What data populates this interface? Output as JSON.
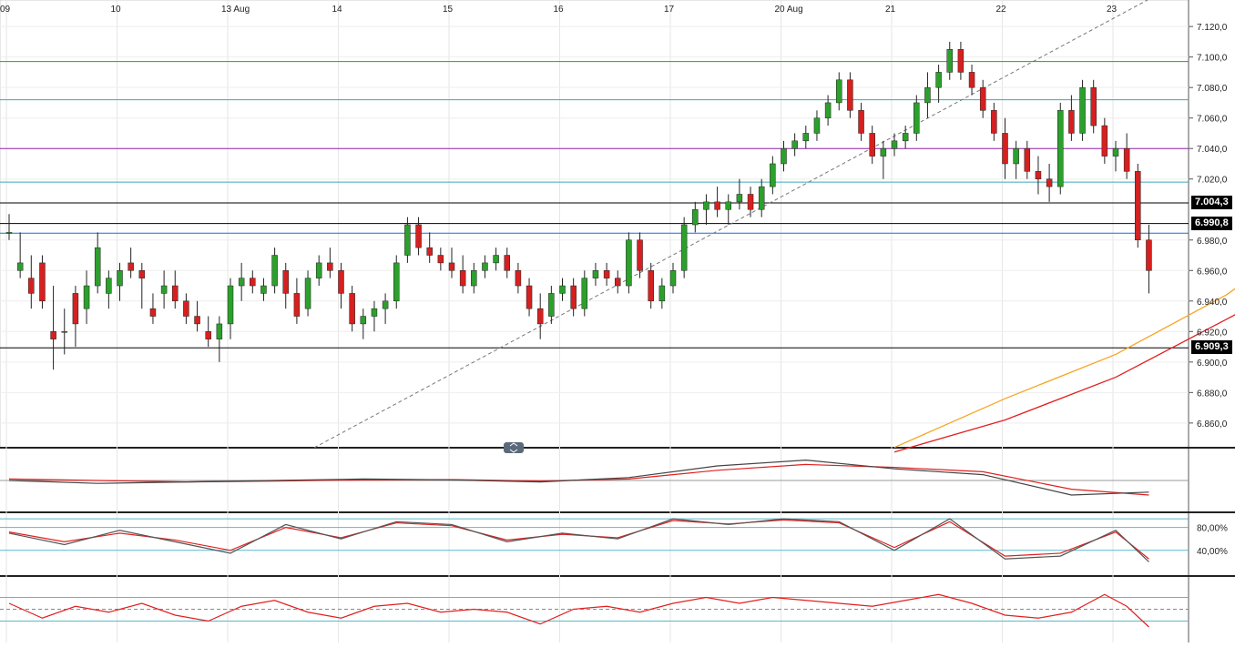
{
  "chart_data": [
    {
      "type": "line",
      "series_kind": "candlestick",
      "title": "",
      "xlabel": "",
      "ylabel": "",
      "x_ticks": [
        "09",
        "10",
        "13 Aug",
        "14",
        "15",
        "16",
        "17",
        "20 Aug",
        "21",
        "22",
        "23"
      ],
      "y_ticks": [
        "7.120,0",
        "7.100,0",
        "7.080,0",
        "7.060,0",
        "7.040,0",
        "7.020,0",
        "6.980,0",
        "6.960,0",
        "6.940,0",
        "6.920,0",
        "6.900,0",
        "6.880,0",
        "6.860,0"
      ],
      "ylim": [
        6.845,
        7.135
      ],
      "price_labels": [
        "7.004,3",
        "6.990,8",
        "6.909,3"
      ],
      "horizontal_levels": [
        {
          "value": 7.097,
          "color": "#2ca02c"
        },
        {
          "value": 7.072,
          "color": "#3fa7b8"
        },
        {
          "value": 7.04,
          "color": "#8e24aa"
        },
        {
          "value": 7.018,
          "color": "#3fa7b8"
        },
        {
          "value": 7.0043,
          "color": "#000000"
        },
        {
          "value": 6.9908,
          "color": "#000000"
        },
        {
          "value": 6.9845,
          "color": "#1f6fd6"
        },
        {
          "value": 6.9093,
          "color": "#000000"
        }
      ],
      "ma_long_orange": [
        [
          8.0,
          6.844
        ],
        [
          9.0,
          6.876
        ],
        [
          10.0,
          6.905
        ],
        [
          11.0,
          6.944
        ],
        [
          11.6,
          6.975
        ],
        [
          11.9,
          6.98
        ]
      ],
      "ma_long_red": [
        [
          8.0,
          6.841
        ],
        [
          9.0,
          6.862
        ],
        [
          10.0,
          6.89
        ],
        [
          11.0,
          6.928
        ],
        [
          11.6,
          6.951
        ],
        [
          11.9,
          6.955
        ]
      ],
      "candles": [
        [
          0.0,
          6.985,
          6.997,
          6.98,
          6.985
        ],
        [
          0.1,
          6.96,
          6.985,
          6.955,
          6.965
        ],
        [
          0.2,
          6.955,
          6.97,
          6.935,
          6.945
        ],
        [
          0.3,
          6.965,
          6.97,
          6.935,
          6.94
        ],
        [
          0.4,
          6.92,
          6.95,
          6.895,
          6.915
        ],
        [
          0.5,
          6.92,
          6.935,
          6.905,
          6.92
        ],
        [
          0.6,
          6.945,
          6.95,
          6.91,
          6.925
        ],
        [
          0.7,
          6.935,
          6.96,
          6.925,
          6.95
        ],
        [
          0.8,
          6.95,
          6.985,
          6.945,
          6.975
        ],
        [
          0.9,
          6.945,
          6.96,
          6.935,
          6.955
        ],
        [
          1.0,
          6.95,
          6.965,
          6.94,
          6.96
        ],
        [
          1.1,
          6.965,
          6.975,
          6.955,
          6.96
        ],
        [
          1.2,
          6.96,
          6.965,
          6.935,
          6.955
        ],
        [
          1.3,
          6.935,
          6.945,
          6.925,
          6.93
        ],
        [
          1.4,
          6.945,
          6.96,
          6.935,
          6.95
        ],
        [
          1.5,
          6.95,
          6.96,
          6.935,
          6.94
        ],
        [
          1.6,
          6.94,
          6.945,
          6.925,
          6.93
        ],
        [
          1.7,
          6.93,
          6.94,
          6.92,
          6.925
        ],
        [
          1.8,
          6.92,
          6.93,
          6.91,
          6.915
        ],
        [
          1.9,
          6.915,
          6.93,
          6.9,
          6.925
        ],
        [
          2.0,
          6.925,
          6.955,
          6.915,
          6.95
        ],
        [
          2.1,
          6.95,
          6.965,
          6.94,
          6.955
        ],
        [
          2.2,
          6.955,
          6.96,
          6.945,
          6.95
        ],
        [
          2.3,
          6.945,
          6.955,
          6.94,
          6.95
        ],
        [
          2.4,
          6.95,
          6.975,
          6.945,
          6.97
        ],
        [
          2.5,
          6.96,
          6.965,
          6.935,
          6.945
        ],
        [
          2.6,
          6.945,
          6.955,
          6.925,
          6.93
        ],
        [
          2.7,
          6.935,
          6.96,
          6.93,
          6.955
        ],
        [
          2.8,
          6.955,
          6.97,
          6.95,
          6.965
        ],
        [
          2.9,
          6.965,
          6.975,
          6.955,
          6.96
        ],
        [
          3.0,
          6.96,
          6.965,
          6.935,
          6.945
        ],
        [
          3.1,
          6.945,
          6.95,
          6.92,
          6.925
        ],
        [
          3.2,
          6.925,
          6.935,
          6.915,
          6.93
        ],
        [
          3.3,
          6.93,
          6.94,
          6.92,
          6.935
        ],
        [
          3.4,
          6.935,
          6.945,
          6.925,
          6.94
        ],
        [
          3.5,
          6.94,
          6.97,
          6.935,
          6.965
        ],
        [
          3.6,
          6.97,
          6.995,
          6.965,
          6.99
        ],
        [
          3.7,
          6.99,
          6.995,
          6.97,
          6.975
        ],
        [
          3.8,
          6.975,
          6.985,
          6.965,
          6.97
        ],
        [
          3.9,
          6.97,
          6.975,
          6.96,
          6.965
        ],
        [
          4.0,
          6.965,
          6.975,
          6.955,
          6.96
        ],
        [
          4.1,
          6.96,
          6.97,
          6.945,
          6.95
        ],
        [
          4.2,
          6.95,
          6.965,
          6.945,
          6.96
        ],
        [
          4.3,
          6.96,
          6.97,
          6.955,
          6.965
        ],
        [
          4.4,
          6.965,
          6.975,
          6.96,
          6.97
        ],
        [
          4.5,
          6.97,
          6.975,
          6.955,
          6.96
        ],
        [
          4.6,
          6.96,
          6.965,
          6.945,
          6.95
        ],
        [
          4.7,
          6.95,
          6.955,
          6.93,
          6.935
        ],
        [
          4.8,
          6.935,
          6.945,
          6.915,
          6.925
        ],
        [
          4.9,
          6.93,
          6.95,
          6.925,
          6.945
        ],
        [
          5.0,
          6.945,
          6.955,
          6.94,
          6.95
        ],
        [
          5.1,
          6.95,
          6.955,
          6.93,
          6.935
        ],
        [
          5.2,
          6.935,
          6.96,
          6.93,
          6.955
        ],
        [
          5.3,
          6.955,
          6.965,
          6.95,
          6.96
        ],
        [
          5.4,
          6.96,
          6.965,
          6.95,
          6.955
        ],
        [
          5.5,
          6.955,
          6.96,
          6.945,
          6.95
        ],
        [
          5.6,
          6.95,
          6.985,
          6.945,
          6.98
        ],
        [
          5.7,
          6.98,
          6.985,
          6.955,
          6.96
        ],
        [
          5.8,
          6.96,
          6.965,
          6.935,
          6.94
        ],
        [
          5.9,
          6.94,
          6.955,
          6.935,
          6.95
        ],
        [
          6.0,
          6.95,
          6.965,
          6.945,
          6.96
        ],
        [
          6.1,
          6.96,
          6.995,
          6.955,
          6.99
        ],
        [
          6.2,
          6.99,
          7.005,
          6.985,
          7.0
        ],
        [
          6.3,
          7.0,
          7.01,
          6.99,
          7.005
        ],
        [
          6.4,
          7.005,
          7.015,
          6.995,
          7.0
        ],
        [
          6.5,
          7.0,
          7.01,
          6.99,
          7.005
        ],
        [
          6.6,
          7.005,
          7.02,
          7.0,
          7.01
        ],
        [
          6.7,
          7.01,
          7.015,
          6.995,
          7.0
        ],
        [
          6.8,
          7.0,
          7.02,
          6.995,
          7.015
        ],
        [
          6.9,
          7.015,
          7.035,
          7.01,
          7.03
        ],
        [
          7.0,
          7.03,
          7.045,
          7.025,
          7.04
        ],
        [
          7.1,
          7.04,
          7.05,
          7.035,
          7.045
        ],
        [
          7.2,
          7.045,
          7.055,
          7.04,
          7.05
        ],
        [
          7.3,
          7.05,
          7.065,
          7.045,
          7.06
        ],
        [
          7.4,
          7.06,
          7.075,
          7.055,
          7.07
        ],
        [
          7.5,
          7.07,
          7.09,
          7.065,
          7.085
        ],
        [
          7.6,
          7.085,
          7.09,
          7.06,
          7.065
        ],
        [
          7.7,
          7.065,
          7.07,
          7.045,
          7.05
        ],
        [
          7.8,
          7.05,
          7.055,
          7.03,
          7.035
        ],
        [
          7.9,
          7.035,
          7.045,
          7.02,
          7.04
        ],
        [
          8.0,
          7.04,
          7.05,
          7.035,
          7.045
        ],
        [
          8.1,
          7.045,
          7.055,
          7.04,
          7.05
        ],
        [
          8.2,
          7.05,
          7.075,
          7.045,
          7.07
        ],
        [
          8.3,
          7.07,
          7.09,
          7.06,
          7.08
        ],
        [
          8.4,
          7.08,
          7.095,
          7.07,
          7.09
        ],
        [
          8.5,
          7.09,
          7.11,
          7.085,
          7.105
        ],
        [
          8.6,
          7.105,
          7.11,
          7.085,
          7.09
        ],
        [
          8.7,
          7.09,
          7.095,
          7.075,
          7.08
        ],
        [
          8.8,
          7.08,
          7.085,
          7.06,
          7.065
        ],
        [
          8.9,
          7.065,
          7.07,
          7.045,
          7.05
        ],
        [
          9.0,
          7.05,
          7.06,
          7.02,
          7.03
        ],
        [
          9.1,
          7.03,
          7.045,
          7.02,
          7.04
        ],
        [
          9.2,
          7.04,
          7.045,
          7.02,
          7.025
        ],
        [
          9.3,
          7.025,
          7.035,
          7.01,
          7.02
        ],
        [
          9.4,
          7.02,
          7.03,
          7.005,
          7.015
        ],
        [
          9.5,
          7.015,
          7.07,
          7.01,
          7.065
        ],
        [
          9.6,
          7.065,
          7.075,
          7.045,
          7.05
        ],
        [
          9.7,
          7.05,
          7.085,
          7.045,
          7.08
        ],
        [
          9.8,
          7.08,
          7.085,
          7.05,
          7.055
        ],
        [
          9.9,
          7.055,
          7.06,
          7.03,
          7.035
        ],
        [
          10.0,
          7.035,
          7.045,
          7.025,
          7.04
        ],
        [
          10.1,
          7.04,
          7.05,
          7.02,
          7.025
        ],
        [
          10.2,
          7.025,
          7.03,
          6.975,
          6.98
        ],
        [
          10.3,
          6.98,
          6.99,
          6.945,
          6.96
        ]
      ]
    },
    {
      "type": "area",
      "series_kind": "macd-histogram",
      "title": "",
      "ylim": [
        -1,
        1
      ],
      "x": [
        0.0,
        0.8,
        1.6,
        2.4,
        3.2,
        4.0,
        4.8,
        5.6,
        6.4,
        7.2,
        8.0,
        8.8,
        9.6,
        10.3
      ],
      "macd": [
        0.0,
        -0.1,
        -0.05,
        0.0,
        0.05,
        0.02,
        -0.05,
        0.1,
        0.5,
        0.7,
        0.4,
        0.2,
        -0.5,
        -0.4
      ],
      "signal": [
        0.05,
        0.0,
        -0.05,
        -0.02,
        0.02,
        0.03,
        -0.02,
        0.05,
        0.35,
        0.55,
        0.45,
        0.3,
        -0.3,
        -0.5
      ]
    },
    {
      "type": "line",
      "series_kind": "stochastic",
      "title": "",
      "y_ticks": [
        "80,00%",
        "40,00%"
      ],
      "ylim": [
        0,
        100
      ],
      "levels": [
        95,
        80,
        40
      ],
      "x": [
        0.0,
        0.5,
        1.0,
        1.5,
        2.0,
        2.5,
        3.0,
        3.5,
        4.0,
        4.5,
        5.0,
        5.5,
        6.0,
        6.5,
        7.0,
        7.5,
        8.0,
        8.5,
        9.0,
        9.5,
        10.0,
        10.3
      ],
      "k": [
        70,
        50,
        75,
        55,
        35,
        85,
        60,
        90,
        85,
        55,
        70,
        60,
        95,
        85,
        95,
        90,
        40,
        95,
        25,
        30,
        75,
        20
      ],
      "d": [
        72,
        55,
        70,
        58,
        40,
        80,
        62,
        88,
        83,
        58,
        68,
        62,
        92,
        86,
        93,
        88,
        45,
        90,
        30,
        35,
        72,
        25
      ]
    },
    {
      "type": "line",
      "series_kind": "rsi",
      "title": "",
      "ylim": [
        0,
        100
      ],
      "levels": [
        70,
        50,
        30
      ],
      "x": [
        0.0,
        0.3,
        0.6,
        0.9,
        1.2,
        1.5,
        1.8,
        2.1,
        2.4,
        2.7,
        3.0,
        3.3,
        3.6,
        3.9,
        4.2,
        4.5,
        4.8,
        5.1,
        5.4,
        5.7,
        6.0,
        6.3,
        6.6,
        6.9,
        7.2,
        7.5,
        7.8,
        8.1,
        8.4,
        8.7,
        9.0,
        9.3,
        9.6,
        9.9,
        10.1,
        10.3
      ],
      "values": [
        60,
        35,
        55,
        45,
        60,
        40,
        30,
        55,
        65,
        45,
        35,
        55,
        60,
        45,
        50,
        45,
        25,
        50,
        55,
        45,
        60,
        70,
        60,
        70,
        65,
        60,
        55,
        65,
        75,
        60,
        40,
        35,
        45,
        75,
        55,
        20
      ]
    }
  ]
}
